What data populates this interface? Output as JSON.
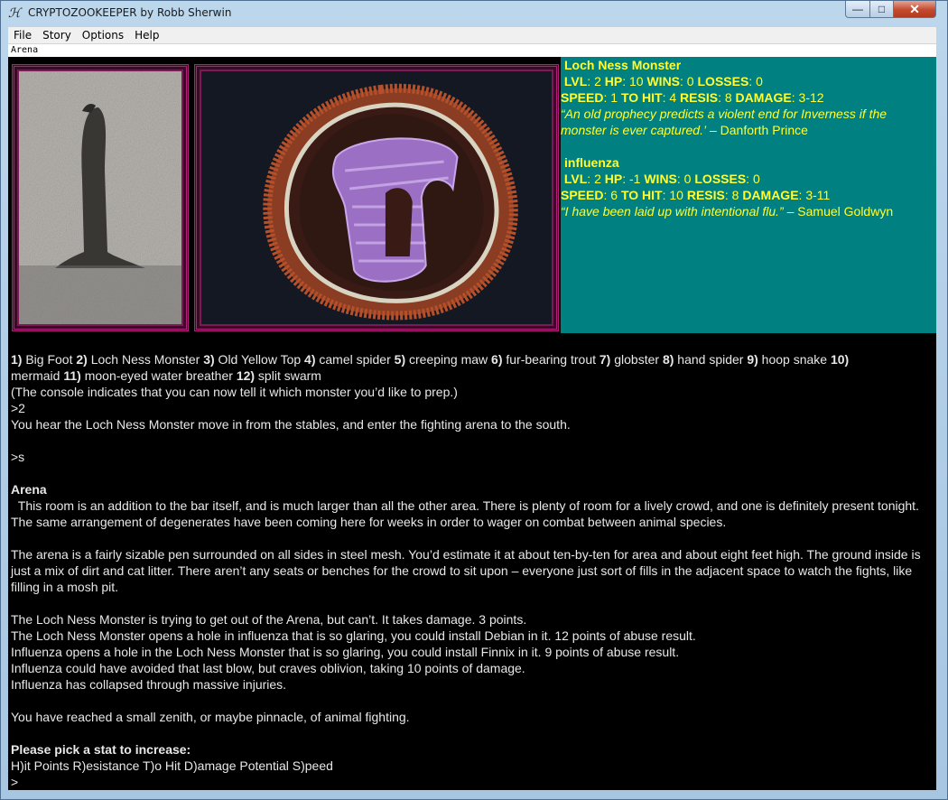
{
  "window": {
    "title": "CRYPTOZOOKEEPER by Robb Sherwin",
    "app_icon": "wiz-icon",
    "min_glyph": "—",
    "max_glyph": "□",
    "close_glyph": "✕"
  },
  "menu": [
    "File",
    "Story",
    "Options",
    "Help"
  ],
  "status_line": "Arena",
  "colors": {
    "panel_bg": "#008080",
    "panel_text": "#ffff33",
    "frame": "#b0207a",
    "background": "#000000",
    "text": "#e8e8e8"
  },
  "monsters": [
    {
      "name": "Loch Ness Monster",
      "stats_line1": {
        "LVL": "LVL",
        "lvl_val": ": 2 ",
        "HP": "HP",
        "hp_val": ": 10 ",
        "WINS": "WINS",
        "wins_val": ": 0 ",
        "LOSSES": "LOSSES",
        "losses_val": ": 0"
      },
      "stats_line2": {
        "SPEED": "SPEED",
        "speed_val": ": 1 ",
        "TOHIT": "TO HIT",
        "tohit_val": ": 4 ",
        "RESIS": "RESIS",
        "resis_val": ": 8 ",
        "DAMAGE": "DAMAGE",
        "damage_val": ": 3-12"
      },
      "quote_1": "“An old prophecy predicts a violent end for Inverness if the",
      "quote_2": "monster is ever captured.’",
      "author": " – Danforth Prince"
    },
    {
      "name": "influenza",
      "stats_line1": {
        "LVL": "LVL",
        "lvl_val": ": 2 ",
        "HP": "HP",
        "hp_val": ": -1 ",
        "WINS": "WINS",
        "wins_val": ": 0 ",
        "LOSSES": "LOSSES",
        "losses_val": ": 0"
      },
      "stats_line2": {
        "SPEED": "SPEED",
        "speed_val": ": 6 ",
        "TOHIT": "TO HIT",
        "tohit_val": ": 10 ",
        "RESIS": "RESIS",
        "resis_val": ": 8 ",
        "DAMAGE": "DAMAGE",
        "damage_val": ": 3-11"
      },
      "quote_1": "“I have been laid up with intentional flu.”",
      "author": " –  Samuel Goldwyn"
    }
  ],
  "transcript": {
    "monster_list": [
      {
        "n": "1)",
        "name": " Big Foot "
      },
      {
        "n": "2)",
        "name": " Loch Ness Monster "
      },
      {
        "n": "3)",
        "name": " Old Yellow Top "
      },
      {
        "n": "4)",
        "name": " camel spider "
      },
      {
        "n": "5)",
        "name": " creeping maw "
      },
      {
        "n": "6)",
        "name": " fur-bearing trout "
      },
      {
        "n": "7)",
        "name": " globster "
      },
      {
        "n": "8)",
        "name": " hand spider "
      },
      {
        "n": "9)",
        "name": " hoop snake "
      },
      {
        "n": "10)",
        "name": ""
      },
      {
        "n": "",
        "name": "mermaid "
      },
      {
        "n": "11)",
        "name": " moon-eyed water breather "
      },
      {
        "n": "12)",
        "name": " split swarm"
      }
    ],
    "console_hint": "(The console indicates that you can now tell it which monster you’d like to prep.)",
    "cmd1": ">2",
    "move_msg": "You hear the Loch Ness Monster move in from the stables, and enter the fighting arena to the south.",
    "cmd2": ">s",
    "room_name": "Arena",
    "room_desc_1": "  This room is an addition to the bar itself, and is much larger than all the other area. There is plenty of room for a lively crowd, and one is definitely present tonight. The same arrangement of degenerates have been coming here for weeks in order to wager on combat between animal species.",
    "room_desc_2": "The arena is a fairly sizable pen surrounded on all sides in steel mesh. You’d estimate it at about ten-by-ten for area and about eight feet high. The ground inside is just a mix of dirt and cat litter.  There aren’t any seats or benches for the crowd to sit upon – everyone just sort of fills in the adjacent space to watch the fights, like filling in a mosh pit.",
    "combat": [
      "The Loch Ness Monster is trying to get out of the Arena, but can’t. It takes damage. 3 points.",
      "The Loch Ness Monster opens a hole in influenza that is so glaring, you could install Debian in it. 12 points of abuse result.",
      "Influenza opens a hole in the Loch Ness Monster that is so glaring, you could install Finnix in it. 9 points of abuse result.",
      "Influenza could have avoided that last blow, but craves oblivion, taking 10 points of damage.",
      "Influenza has collapsed through massive injuries."
    ],
    "zenith": "You have reached a small zenith, or maybe pinnacle, of animal fighting.",
    "pick_stat": "Please pick a stat to increase:",
    "stat_options": "H)it Points R)esistance T)o Hit D)amage Potential S)peed",
    "prompt": ">"
  }
}
